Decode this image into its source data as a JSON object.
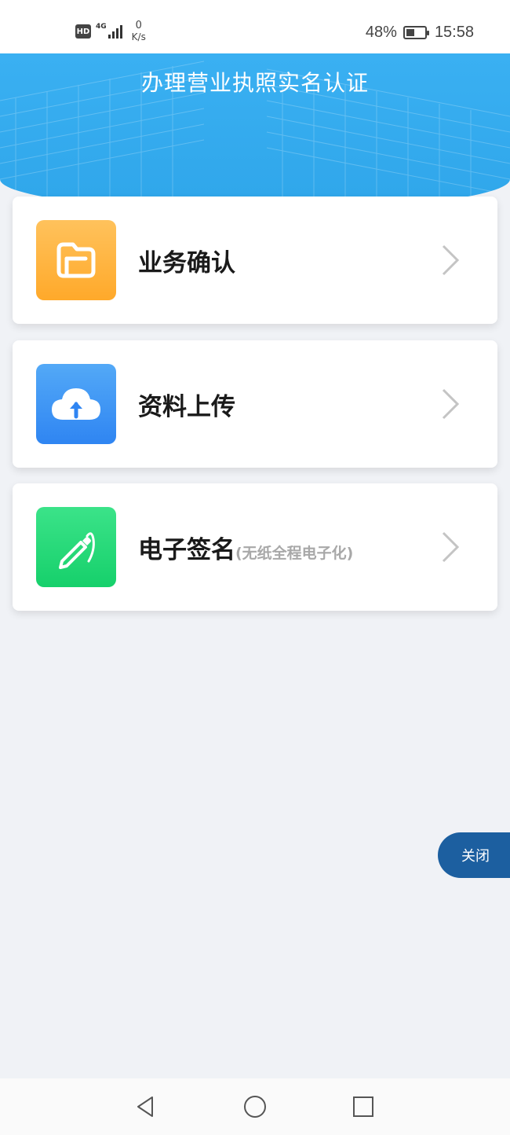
{
  "status_bar": {
    "hd": "HD",
    "network": "4G",
    "speed_value": "0",
    "speed_unit": "K/s",
    "battery_percent": "48%",
    "battery_level": 0.48,
    "time": "15:58"
  },
  "header": {
    "title": "办理营业执照实名认证"
  },
  "cards": [
    {
      "label": "业务确认",
      "sublabel": "",
      "icon": "folder-icon",
      "color": "#ffb339"
    },
    {
      "label": "资料上传",
      "sublabel": "",
      "icon": "cloud-upload-icon",
      "color": "#3d95f5"
    },
    {
      "label": "电子签名",
      "sublabel": "(无纸全程电子化)",
      "icon": "pen-icon",
      "color": "#24d877"
    }
  ],
  "close_button": {
    "label": "关闭"
  },
  "colors": {
    "header_blue": "#3ab0f2",
    "close_blue": "#1c5fa0",
    "background": "#f0f2f6"
  }
}
